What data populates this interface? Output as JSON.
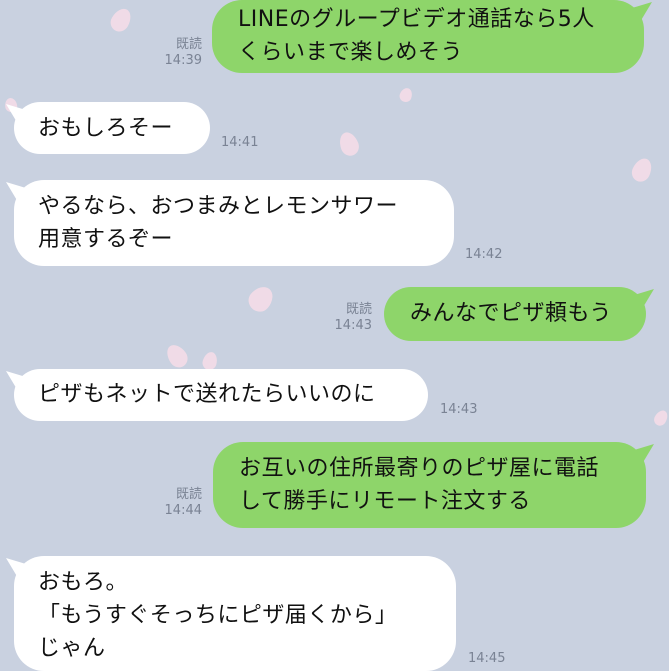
{
  "messages": [
    {
      "side": "out",
      "lines": "LINEのグループビデオ通話なら5人\nくらいまで楽しめそう",
      "read": "既読",
      "time": "14:39"
    },
    {
      "side": "in",
      "lines": "おもしろそー",
      "time": "14:41"
    },
    {
      "side": "in",
      "lines": "やるなら、おつまみとレモンサワー\n用意するぞー",
      "time": "14:42"
    },
    {
      "side": "out",
      "lines": "みんなでピザ頼もう",
      "read": "既読",
      "time": "14:43"
    },
    {
      "side": "in",
      "lines": "ピザもネットで送れたらいいのに",
      "time": "14:43"
    },
    {
      "side": "out",
      "lines": "お互いの住所最寄りのピザ屋に電話\nして勝手にリモート注文する",
      "read": "既読",
      "time": "14:44"
    },
    {
      "side": "in",
      "lines": "おもろ。\n「もうすぐそっちにピザ届くから」\nじゃん",
      "time": "14:45"
    }
  ],
  "colors": {
    "background": "#c9d1e0",
    "outgoing": "#8ed56a",
    "incoming": "#ffffff",
    "petal": "#f7dde8"
  }
}
